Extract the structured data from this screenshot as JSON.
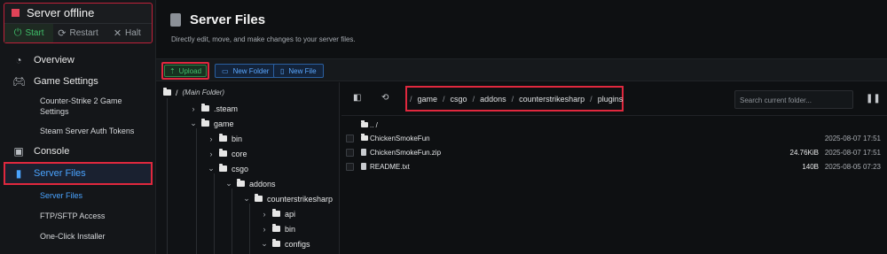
{
  "server_status": {
    "label": "Server offline",
    "start": "Start",
    "restart": "Restart",
    "halt": "Halt"
  },
  "nav": {
    "overview": "Overview",
    "game_settings": "Game Settings",
    "cs2_settings": "Counter-Strike 2 Game Settings",
    "auth_tokens": "Steam Server Auth Tokens",
    "console": "Console",
    "server_files": "Server Files",
    "sub_server_files": "Server Files",
    "ftp": "FTP/SFTP Access",
    "installer": "One-Click Installer"
  },
  "page": {
    "title": "Server Files",
    "subtitle": "Directly edit, move, and make changes to your server files."
  },
  "toolbar": {
    "upload": "Upload",
    "new_folder": "New Folder",
    "new_file": "New File"
  },
  "tree": {
    "root": "/",
    "root_note": "(Main Folder)",
    "items": [
      ".steam",
      "game",
      "bin",
      "core",
      "csgo",
      "addons",
      "counterstrikesharp",
      "api",
      "bin",
      "configs"
    ]
  },
  "breadcrumb": [
    "/",
    "game",
    "/",
    "csgo",
    "/",
    "addons",
    "/",
    "counterstrikesharp",
    "/",
    "plugins"
  ],
  "search": {
    "placeholder": "Search current folder..."
  },
  "files": {
    "parent": ".. /",
    "rows": [
      {
        "name": "ChickenSmokeFun",
        "size": "",
        "date": "2025-08-07 17:51"
      },
      {
        "name": "ChickenSmokeFun.zip",
        "size": "24.76KiB",
        "date": "2025-08-07 17:51"
      },
      {
        "name": "README.txt",
        "size": "140B",
        "date": "2025-08-05 07:23"
      }
    ]
  },
  "colors": {
    "accent_blue": "#4aa3ff",
    "highlight_red": "#e0283e",
    "success_green": "#43c26b"
  }
}
